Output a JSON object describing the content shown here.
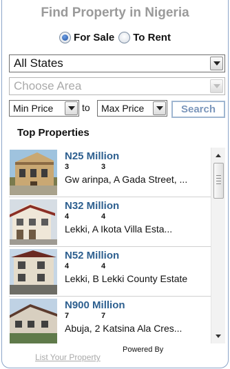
{
  "header": {
    "title": "Find Property in Nigeria"
  },
  "listing_type": {
    "options": [
      {
        "label": "For Sale",
        "selected": true
      },
      {
        "label": "To Rent",
        "selected": false
      }
    ]
  },
  "filters": {
    "state": "All States",
    "area_placeholder": "Choose Area",
    "min_price": "Min Price",
    "to_label": "to",
    "max_price": "Max Price",
    "search_label": "Search"
  },
  "top_properties": {
    "title": "Top Properties",
    "items": [
      {
        "price": "N25 Million",
        "beds": "3",
        "baths": "3",
        "address": "Gw arinpa, A Gada Street, ..."
      },
      {
        "price": "N32 Million",
        "beds": "4",
        "baths": "4",
        "address": "Lekki, A Ikota Villa Esta..."
      },
      {
        "price": "N52 Million",
        "beds": "4",
        "baths": "4",
        "address": "Lekki, B Lekki County Estate"
      },
      {
        "price": "N900 Million",
        "beds": "7",
        "baths": "7",
        "address": "Abuja, 2 Katsina Ala Cres..."
      }
    ]
  },
  "footer": {
    "list_link": "List Your Property",
    "powered_by": "Powered By"
  },
  "colors": {
    "title_gray": "#9a9a9a",
    "price_blue": "#2d5f8f",
    "border_blue": "#8aa4c8",
    "search_text": "#7b96bb"
  }
}
